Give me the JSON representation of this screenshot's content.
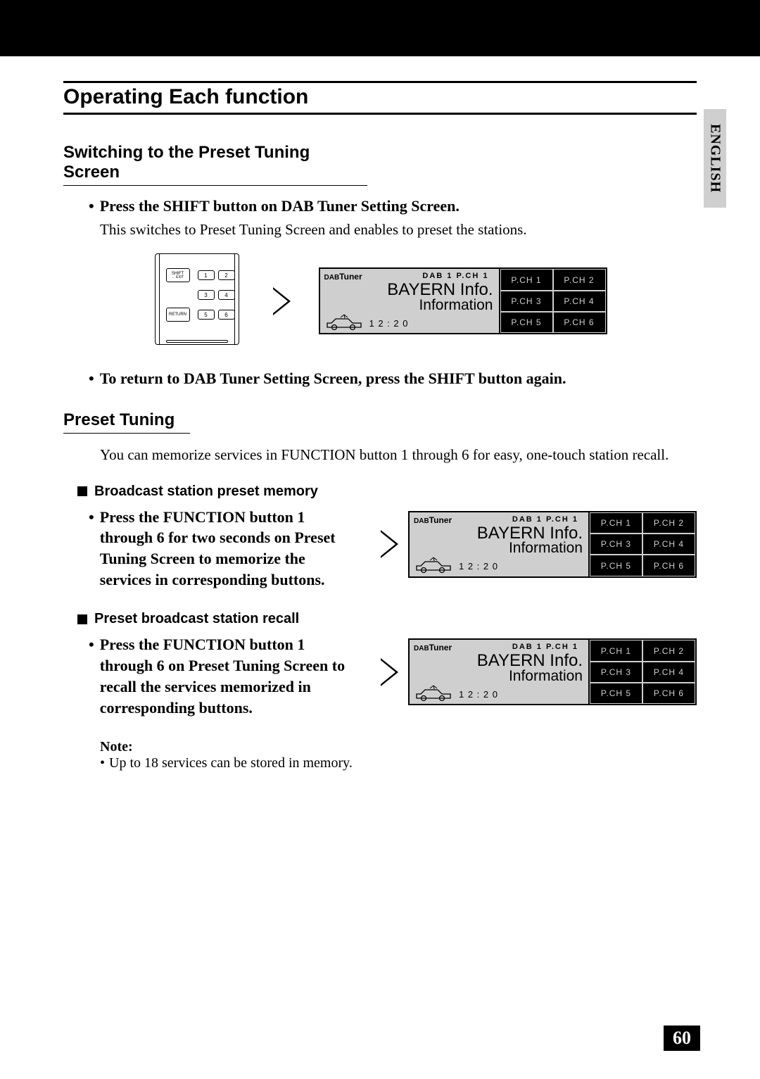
{
  "language_tab": "ENGLISH",
  "page_number": "60",
  "section_title": "Operating Each function",
  "switch_section": {
    "heading": "Switching to the Preset Tuning Screen",
    "step1": "Press the SHIFT button on DAB Tuner Setting Screen.",
    "step1_body": "This switches to Preset Tuning Screen and enables to preset the stations.",
    "return_note": "To return to DAB Tuner Setting Screen, press the SHIFT button again."
  },
  "preset_section": {
    "heading": "Preset Tuning",
    "intro": "You can memorize services in FUNCTION button 1 through 6 for easy, one-touch station recall.",
    "memory_heading": "Broadcast station preset memory",
    "memory_step": "Press the FUNCTION button 1 through 6 for two seconds on Preset Tuning Screen to memorize the services in corresponding buttons.",
    "recall_heading": "Preset broadcast station recall",
    "recall_step": "Press the FUNCTION button 1 through 6 on Preset Tuning Screen to recall the services memorized in corresponding buttons.",
    "note_label": "Note:",
    "note_item": "Up to 18 services can be stored in memory."
  },
  "lcd": {
    "dab": "DAB",
    "tuner": "Tuner",
    "status": "DAB 1    P.CH 1",
    "main": "BAYERN Info.",
    "sub": "Information",
    "time": "1 2 : 2 0",
    "buttons": [
      "P.CH  1",
      "P.CH  2",
      "P.CH  3",
      "P.CH  4",
      "P.CH  5",
      "P.CH  6"
    ]
  },
  "remote": {
    "shift": "SHIFT",
    "exit": "← EXIT",
    "return": "RETURN",
    "btn1": "1",
    "btn2": "2",
    "btn3": "3",
    "btn4": "4",
    "btn5": "5",
    "btn6": "6"
  }
}
